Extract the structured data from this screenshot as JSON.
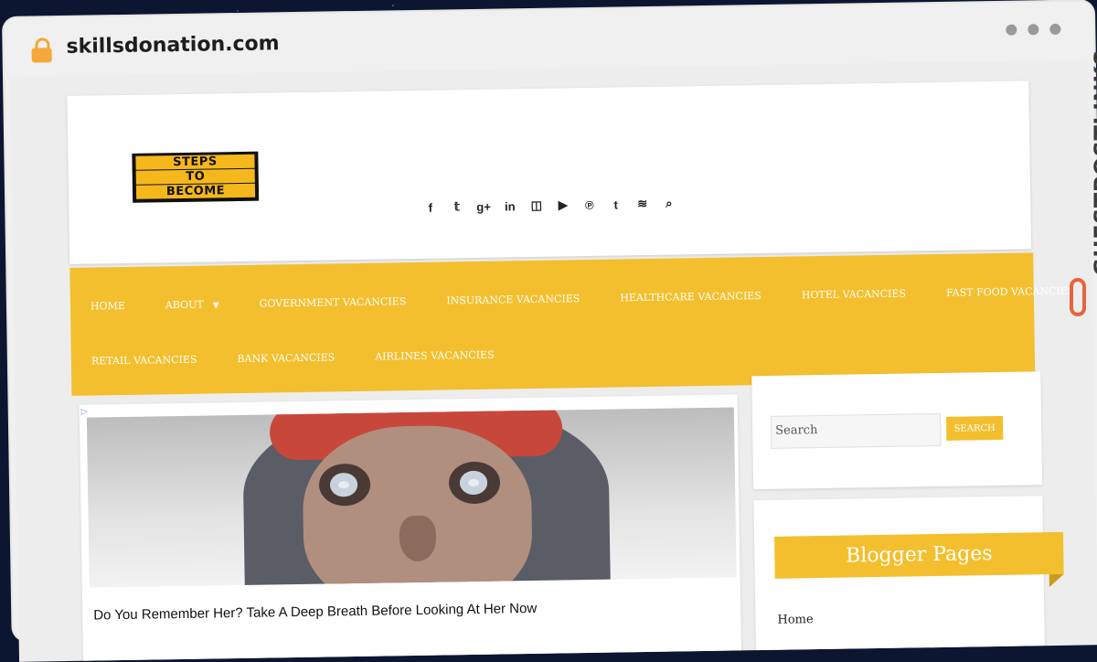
{
  "browser": {
    "url": "skillsdonation.com",
    "lock_icon": "lock-icon"
  },
  "site": {
    "logo": [
      "STEPS",
      "TO",
      "BECOME"
    ],
    "social_icons": [
      "facebook-icon",
      "twitter-icon",
      "google-plus-icon",
      "linkedin-icon",
      "instagram-icon",
      "youtube-icon",
      "pinterest-icon",
      "tumblr-icon",
      "rss-icon",
      "search-icon"
    ],
    "social_glyphs": [
      "f",
      "𝕥",
      "g+",
      "in",
      "◫",
      "▶",
      "℗",
      "t",
      "≋",
      "⌕"
    ],
    "nav_row1": [
      "HOME",
      "ABOUT",
      "GOVERNMENT VACANCIES",
      "INSURANCE VACANCIES",
      "HEALTHCARE VACANCIES",
      "HOTEL VACANCIES",
      "FAST FOOD VACANCIES"
    ],
    "nav_row2": [
      "RETAIL VACANCIES",
      "BANK VACANCIES",
      "AIRLINES VACANCIES"
    ],
    "about_caret": "▼"
  },
  "ad": {
    "badge": "▷",
    "title": "Do You Remember Her? Take A Deep Breath Before Looking At Her Now"
  },
  "sidebar": {
    "search_placeholder": "Search",
    "search_button": "SEARCH",
    "pages_title": "Blogger Pages",
    "pages_first": "Home"
  },
  "watermark": {
    "text": "GUESTPOSTLINKS"
  },
  "colors": {
    "accent": "#f4bf2e",
    "brand_orange": "#e8643d"
  }
}
